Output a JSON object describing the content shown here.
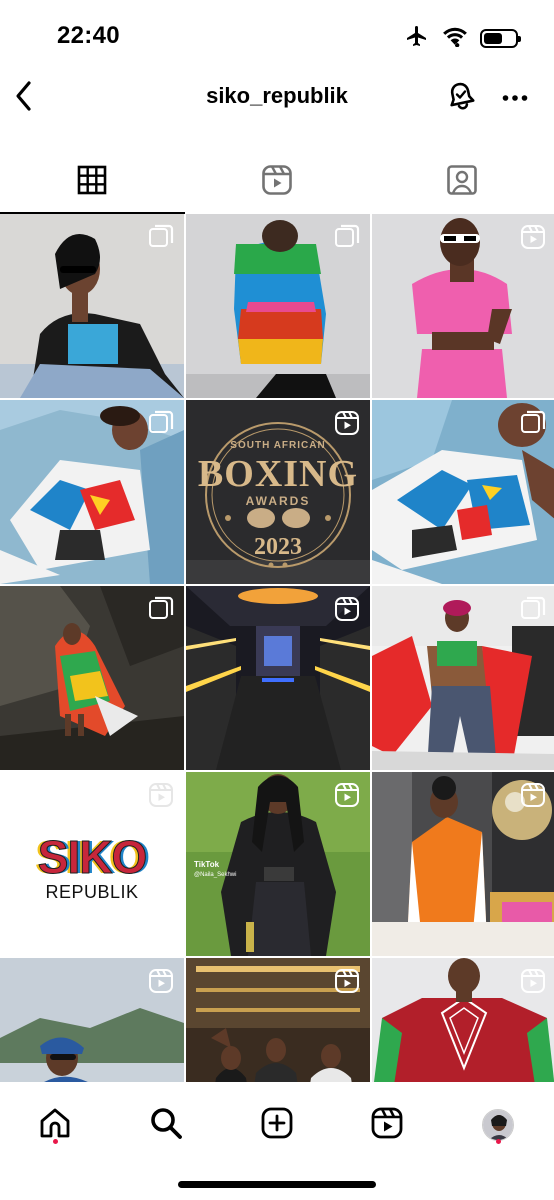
{
  "status_bar": {
    "time": "22:40",
    "icons": [
      "airplane-icon",
      "wifi-icon",
      "battery-icon"
    ],
    "battery_level": 0.6
  },
  "header": {
    "username": "siko_republik",
    "back_icon": "chevron-left-icon",
    "notification_icon": "bell-icon",
    "more_icon": "more-horizontal-icon"
  },
  "tabs": [
    {
      "name": "posts",
      "icon": "grid-icon",
      "active": true
    },
    {
      "name": "reels",
      "icon": "reels-icon",
      "active": false
    },
    {
      "name": "tagged",
      "icon": "tagged-icon",
      "active": false
    }
  ],
  "posts": [
    {
      "type": "carousel",
      "scene": "woman in blue crop top and black blazer"
    },
    {
      "type": "carousel",
      "scene": "woman in colourful puffer jacket"
    },
    {
      "type": "reel",
      "scene": "woman in pink patterned two-piece"
    },
    {
      "type": "carousel",
      "scene": "woman lying in geometric print dress"
    },
    {
      "type": "reel",
      "scene": "awards logo",
      "logo_line1": "SOUTH AFRICAN",
      "logo_line2": "BOXING",
      "logo_line3": "AWARDS",
      "logo_year": "2023"
    },
    {
      "type": "reel",
      "scene": "woman lying in geometric print dress close-up"
    },
    {
      "type": "carousel",
      "scene": "woman in patterned robe by rocky cliff"
    },
    {
      "type": "reel",
      "scene": "party bus interior with neon lights"
    },
    {
      "type": "carousel",
      "scene": "woman on stage with red cape"
    },
    {
      "type": "reel",
      "scene": "brand logo",
      "logo_main": "SIKO",
      "logo_sub": "REPUBLIK"
    },
    {
      "type": "reel",
      "scene": "woman in black tracksuit on grass",
      "overlay_brand": "TikTok",
      "overlay_handle": "@Naila_Sekhwi"
    },
    {
      "type": "reel",
      "scene": "woman in orange cape in hotel room"
    },
    {
      "type": "reel",
      "scene": "woman with headscarf on boat"
    },
    {
      "type": "reel",
      "scene": "group of women at a bar"
    },
    {
      "type": "reel",
      "scene": "model in red patterned crop top"
    }
  ],
  "bottom_nav": [
    {
      "name": "home",
      "icon": "home-icon",
      "active": true
    },
    {
      "name": "search",
      "icon": "search-icon",
      "active": false
    },
    {
      "name": "create",
      "icon": "plus-square-icon",
      "active": false
    },
    {
      "name": "reels",
      "icon": "reels-icon",
      "active": false
    },
    {
      "name": "profile",
      "icon": "avatar",
      "active": false
    }
  ],
  "colors": {
    "notification_dot": "#e8174a",
    "tab_indicator": "#000000"
  }
}
